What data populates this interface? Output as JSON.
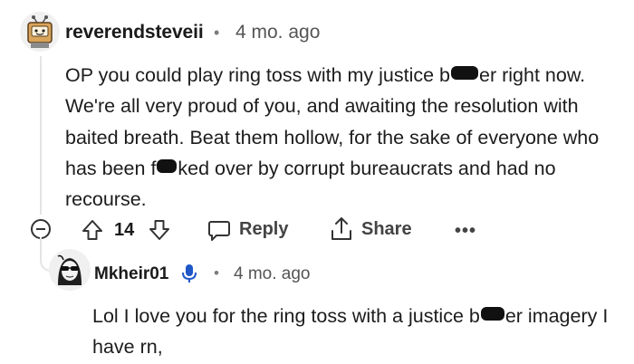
{
  "comment": {
    "username": "reverendsteveii",
    "separator": "•",
    "time": "4 mo. ago",
    "body": {
      "seg1": "OP you could play ring toss with my justice b",
      "seg2": "er right now. We're all very proud of you, and awaiting the resolution with baited breath. Beat them hollow, for the sake of everyone who has been f",
      "seg3": "ked over by corrupt bureaucrats and had no recourse."
    },
    "avatar_icon": "robot-tv-avatar"
  },
  "actions": {
    "vote_count": "14",
    "reply_label": "Reply",
    "share_label": "Share",
    "more_label": "•••",
    "icons": [
      "collapse-icon",
      "upvote-icon",
      "downvote-icon",
      "reply-icon",
      "share-icon",
      "more-icon"
    ]
  },
  "reply": {
    "username": "Mkheir01",
    "separator": "•",
    "time": "4 mo. ago",
    "body": {
      "seg1": "Lol I love you for the ring toss with a justice b",
      "seg2": "er imagery I have rn,"
    },
    "badge_icon": "microphone-icon",
    "avatar_icon": "sunglasses-avatar"
  },
  "colors": {
    "text": "#1a1a1b",
    "muted": "#555555",
    "badge_blue": "#1f57c7",
    "thread_line": "#e4e4e4"
  }
}
